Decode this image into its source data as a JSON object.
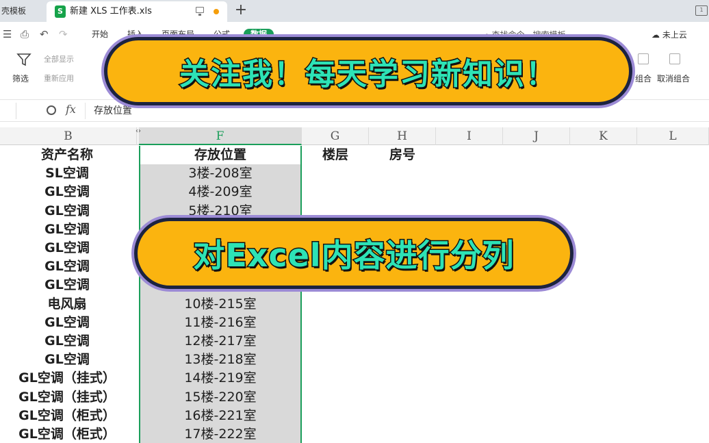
{
  "tabs": {
    "prev_label": "壳模板",
    "active_icon": "S",
    "active_title": "新建 XLS 工作表.xls",
    "new_tab": "+",
    "window_button": "1"
  },
  "menu": {
    "items": [
      "开始",
      "插入",
      "页面布局",
      "公式",
      "数据"
    ],
    "active_index": 4,
    "search_label": "查找命令、搜索模板",
    "cloud_label": "未上云"
  },
  "ribbon": {
    "filter_label": "筛选",
    "show_all": "全部显示",
    "reapply": "重新应用",
    "group_label": "组合",
    "ungroup_label": "取消组合"
  },
  "formula_bar": {
    "namebox": "",
    "fx": "fx",
    "content": "存放位置"
  },
  "columns": [
    "B",
    "F",
    "G",
    "H",
    "I",
    "J",
    "K",
    "L"
  ],
  "selected_column": "F",
  "rows": [
    {
      "b": "资产名称",
      "f": "存放位置",
      "g": "楼层",
      "h": "房号"
    },
    {
      "b": "SL空调",
      "f": "3楼-208室",
      "g": "",
      "h": ""
    },
    {
      "b": "GL空调",
      "f": "4楼-209室",
      "g": "",
      "h": ""
    },
    {
      "b": "GL空调",
      "f": "5楼-210室",
      "g": "",
      "h": ""
    },
    {
      "b": "GL空调",
      "f": "",
      "g": "",
      "h": ""
    },
    {
      "b": "GL空调",
      "f": "",
      "g": "",
      "h": ""
    },
    {
      "b": "GL空调",
      "f": "",
      "g": "",
      "h": ""
    },
    {
      "b": "GL空调",
      "f": "",
      "g": "",
      "h": ""
    },
    {
      "b": "电风扇",
      "f": "10楼-215室",
      "g": "",
      "h": ""
    },
    {
      "b": "GL空调",
      "f": "11楼-216室",
      "g": "",
      "h": ""
    },
    {
      "b": "GL空调",
      "f": "12楼-217室",
      "g": "",
      "h": ""
    },
    {
      "b": "GL空调",
      "f": "13楼-218室",
      "g": "",
      "h": ""
    },
    {
      "b": "GL空调（挂式）",
      "f": "14楼-219室",
      "g": "",
      "h": ""
    },
    {
      "b": "GL空调（挂式）",
      "f": "15楼-220室",
      "g": "",
      "h": ""
    },
    {
      "b": "GL空调（柜式）",
      "f": "16楼-221室",
      "g": "",
      "h": ""
    },
    {
      "b": "GL空调（柜式）",
      "f": "17楼-222室",
      "g": "",
      "h": ""
    }
  ],
  "overlays": {
    "top_banner": "关注我！每天学习新知识！",
    "middle_banner": "对Excel内容进行分列"
  },
  "colors": {
    "accent_green": "#1a9e5a",
    "banner_fill": "#fbb40f",
    "banner_text": "#2de3b6"
  }
}
